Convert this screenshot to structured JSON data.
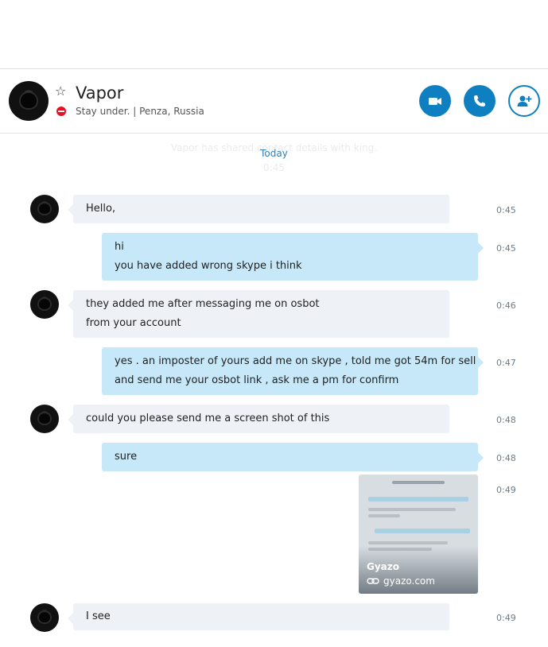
{
  "contact": {
    "name": "Vapor",
    "mood": "Stay under.  |  Penza, Russia",
    "status_color": "#e81123"
  },
  "header_icons": {
    "favorite": "star-outline-icon",
    "video": "video-camera-icon",
    "call": "phone-icon",
    "add": "add-person-icon"
  },
  "system": {
    "shared_text": "Vapor has shared contact details with king.",
    "shared_time": "0:45",
    "day_label": "Today"
  },
  "messages": [
    {
      "direction": "in",
      "lines": [
        "Hello,"
      ],
      "time": "0:45"
    },
    {
      "direction": "out",
      "lines": [
        "hi",
        "you have added wrong skype i think"
      ],
      "time": "0:45"
    },
    {
      "direction": "in",
      "lines": [
        "they added me after messaging me on osbot",
        "from your account"
      ],
      "time": "0:46"
    },
    {
      "direction": "out",
      "lines": [
        "yes . an imposter of yours add me on skype , told me got 54m for sell",
        "and send me your osbot link , ask me a pm for confirm"
      ],
      "time": "0:47"
    },
    {
      "direction": "in",
      "lines": [
        "could you please send me a screen shot of this"
      ],
      "time": "0:48"
    },
    {
      "direction": "out",
      "lines": [
        "sure"
      ],
      "time": "0:48"
    },
    {
      "direction": "out",
      "type": "link-preview",
      "title": "Gyazo",
      "domain": "gyazo.com",
      "time": "0:49"
    },
    {
      "direction": "in",
      "lines": [
        "I see"
      ],
      "time": "0:49"
    }
  ],
  "colors": {
    "accent": "#0e7fc0",
    "incoming_bubble": "#eef1f5",
    "outgoing_bubble": "#c7e8f9",
    "timestamp": "#6a7d8e"
  }
}
